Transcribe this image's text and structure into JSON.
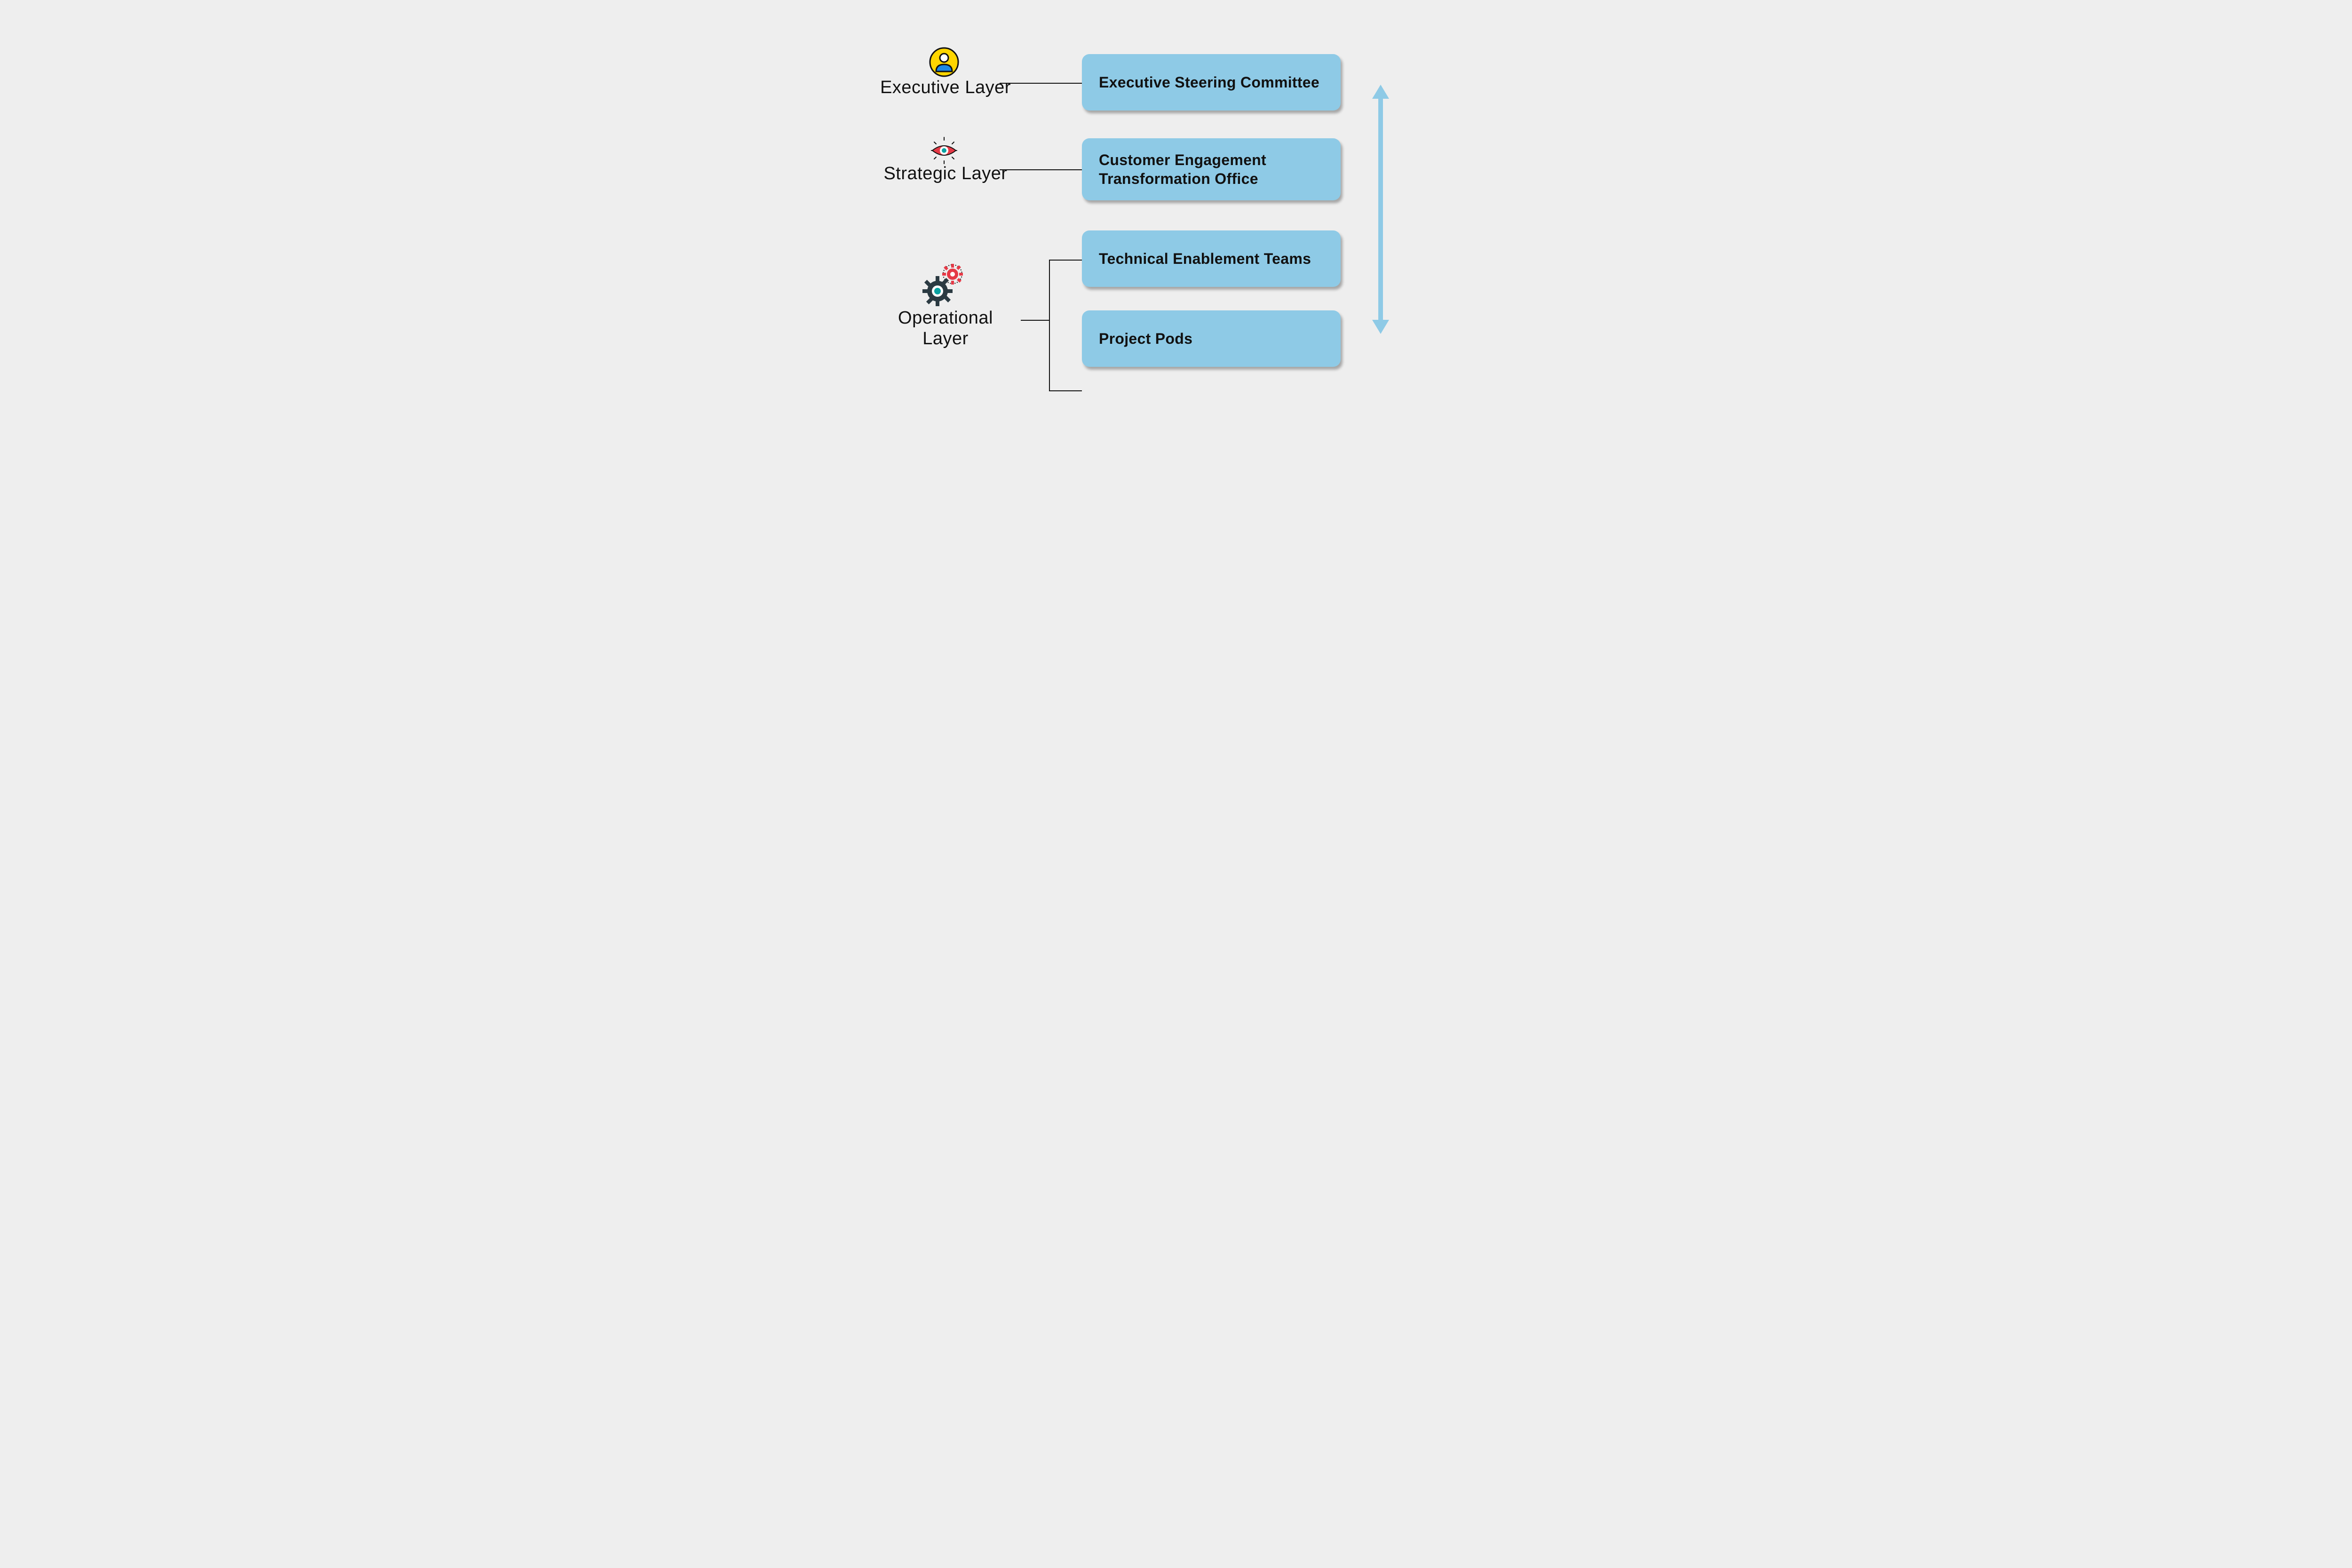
{
  "layers": {
    "executive": {
      "label": "Executive Layer",
      "icon": "person-icon"
    },
    "strategic": {
      "label": "Strategic Layer",
      "icon": "eye-icon"
    },
    "operational": {
      "label": "Operational\nLayer",
      "icon": "gears-icon"
    }
  },
  "nodes": {
    "exec_steering": "Executive Steering Committee",
    "ceto": "Customer Engagement Transformation Office",
    "tech_enable": "Technical Enablement Teams",
    "project_pods": "Project Pods"
  },
  "colors": {
    "node_fill": "#8ecae6",
    "background": "#eeeeee",
    "line": "#111111",
    "arrow": "#8ecae6"
  }
}
